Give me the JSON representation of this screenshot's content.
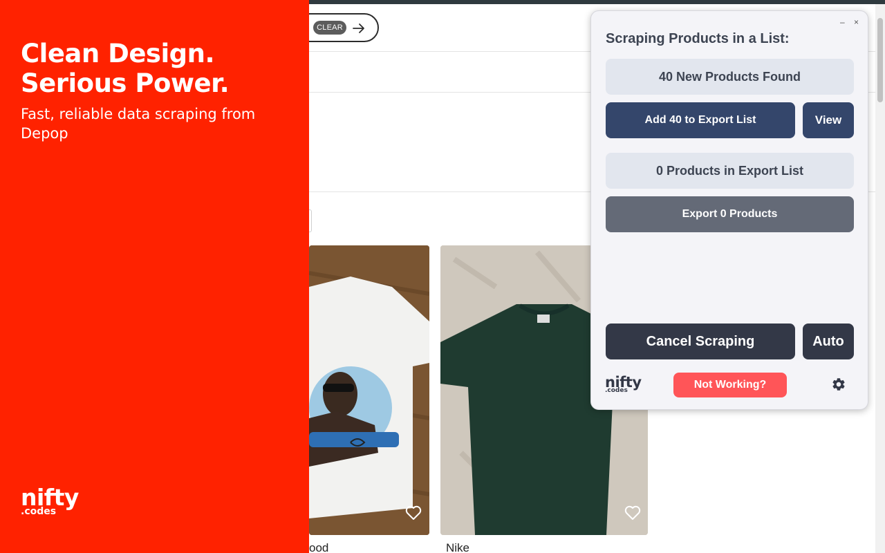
{
  "promo": {
    "headline_line1": "Clean Design.",
    "headline_line2": "Serious Power.",
    "subtitle": "Fast, reliable data scraping from Depop",
    "logo_main": "nifty",
    "logo_sub": ".codes"
  },
  "page": {
    "clear_label": "CLEAR",
    "cards": [
      {
        "label": "ood"
      },
      {
        "label": "Nike"
      }
    ]
  },
  "popup": {
    "minimize": "–",
    "close": "×",
    "title": "Scraping Products in a List:",
    "found_text": "40 New Products Found",
    "add_button": "Add 40 to Export List",
    "view_button": "View",
    "export_list_text": "0 Products in Export List",
    "export_button": "Export 0 Products",
    "cancel_button": "Cancel Scraping",
    "auto_button": "Auto",
    "logo_main": "nifty",
    "logo_sub": ".codes",
    "not_working_button": "Not Working?"
  },
  "colors": {
    "promo_bg": "#ff2200",
    "navy": "#34466b",
    "slate": "#646a77",
    "dark": "#333847",
    "alert_red": "#ff5558"
  }
}
